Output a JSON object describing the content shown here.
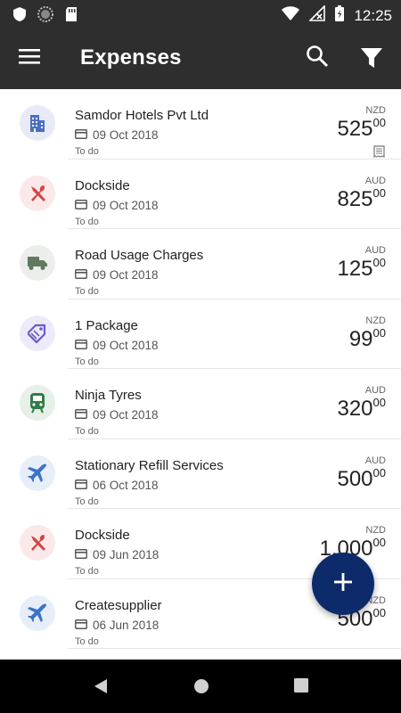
{
  "status_bar": {
    "time": "12:25",
    "icons": [
      "shield-icon",
      "sync-icon",
      "sd-card-icon",
      "wifi-icon",
      "no-sim-icon",
      "battery-icon"
    ]
  },
  "app_bar": {
    "title": "Expenses",
    "icons": [
      "menu-icon",
      "search-icon",
      "filter-icon"
    ]
  },
  "expenses": [
    {
      "name": "Samdor Hotels Pvt Ltd",
      "date": "09 Oct 2018",
      "status": "To do",
      "currency": "NZD",
      "amount_whole": "525",
      "amount_cents": "00",
      "category_icon": "hotel-icon",
      "avatar_bg": "#e8ebf7",
      "icon_color": "#4a6fc1",
      "has_receipt": true
    },
    {
      "name": "Dockside",
      "date": "09 Oct 2018",
      "status": "To do",
      "currency": "AUD",
      "amount_whole": "825",
      "amount_cents": "00",
      "category_icon": "restaurant-icon",
      "avatar_bg": "#fbe9e9",
      "icon_color": "#d64545",
      "has_receipt": false
    },
    {
      "name": "Road Usage Charges",
      "date": "09 Oct 2018",
      "status": "To do",
      "currency": "AUD",
      "amount_whole": "125",
      "amount_cents": "00",
      "category_icon": "truck-icon",
      "avatar_bg": "#eceeec",
      "icon_color": "#5f7a5f",
      "has_receipt": false
    },
    {
      "name": "1 Package",
      "date": "09 Oct 2018",
      "status": "To do",
      "currency": "NZD",
      "amount_whole": "99",
      "amount_cents": "00",
      "category_icon": "tag-icon",
      "avatar_bg": "#eeeafc",
      "icon_color": "#6a5acd",
      "has_receipt": false
    },
    {
      "name": "Ninja Tyres",
      "date": "09 Oct 2018",
      "status": "To do",
      "currency": "AUD",
      "amount_whole": "320",
      "amount_cents": "00",
      "category_icon": "train-icon",
      "avatar_bg": "#e6efe8",
      "icon_color": "#2e7d47",
      "has_receipt": false
    },
    {
      "name": "Stationary Refill Services",
      "date": "06 Oct 2018",
      "status": "To do",
      "currency": "AUD",
      "amount_whole": "500",
      "amount_cents": "00",
      "category_icon": "airplane-icon",
      "avatar_bg": "#e8eef9",
      "icon_color": "#3b73c9",
      "has_receipt": false
    },
    {
      "name": "Dockside",
      "date": "09 Jun 2018",
      "status": "To do",
      "currency": "NZD",
      "amount_whole": "1,000",
      "amount_cents": "00",
      "category_icon": "restaurant-icon",
      "avatar_bg": "#fbe9e9",
      "icon_color": "#d64545",
      "has_receipt": false
    },
    {
      "name": "Createsupplier",
      "date": "06 Jun 2018",
      "status": "To do",
      "currency": "NZD",
      "amount_whole": "500",
      "amount_cents": "00",
      "category_icon": "airplane-icon",
      "avatar_bg": "#e8eef9",
      "icon_color": "#3b73c9",
      "has_receipt": false
    }
  ],
  "fab": {
    "icon": "add-icon",
    "color": "#0d2a6b"
  },
  "nav_bar": {
    "icons": [
      "back-icon",
      "home-icon",
      "recents-icon"
    ]
  }
}
